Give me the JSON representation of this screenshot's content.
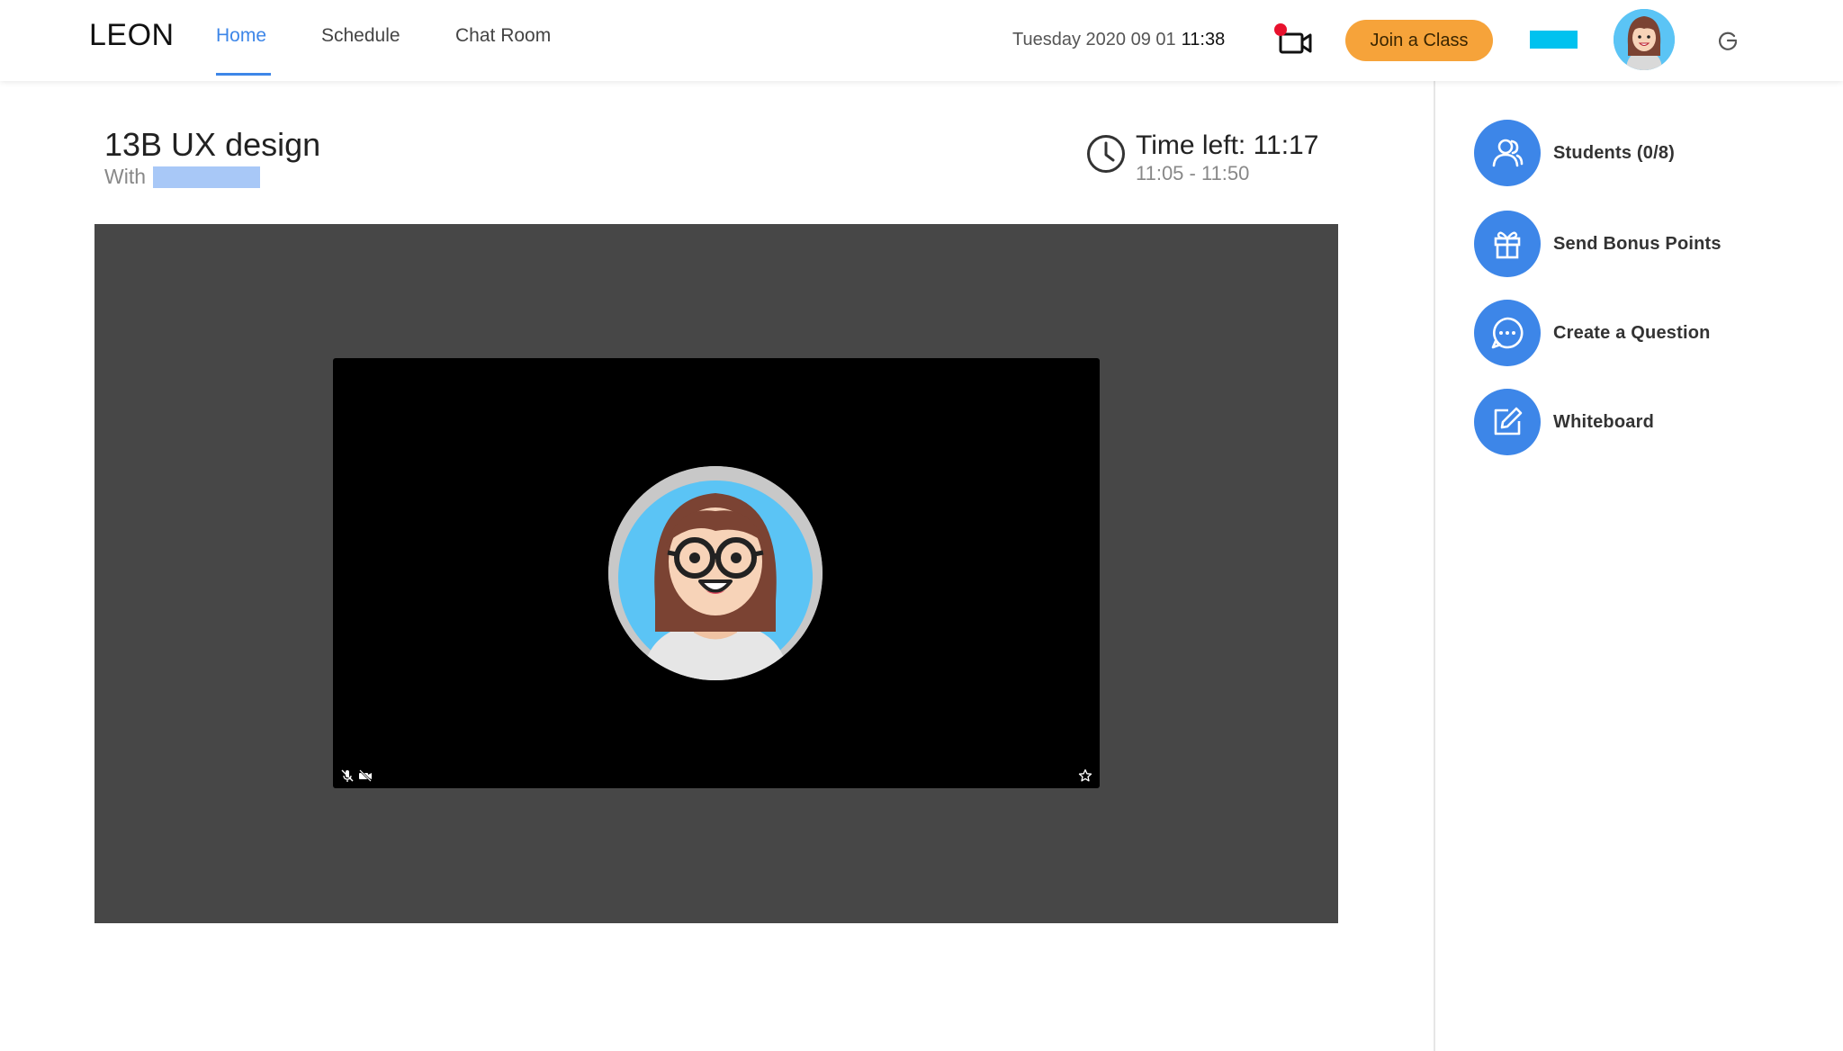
{
  "app": {
    "logo": "LEON"
  },
  "nav": {
    "items": [
      {
        "label": "Home",
        "active": true
      },
      {
        "label": "Schedule",
        "active": false
      },
      {
        "label": "Chat Room",
        "active": false
      }
    ]
  },
  "header": {
    "date": "Tuesday 2020 09 01",
    "time": "11:38",
    "join_label": "Join a Class",
    "icons": [
      "video-record-icon",
      "user-avatar",
      "refresh-icon"
    ]
  },
  "class": {
    "title": "13B UX design",
    "with_label": "With",
    "time_left": "Time left: 11:17",
    "time_range": "11:05 - 11:50"
  },
  "video": {
    "icons": [
      "mic-off-icon",
      "camera-off-icon",
      "star-icon"
    ]
  },
  "actions": [
    {
      "label": "Students (0/8)",
      "icon": "students-icon"
    },
    {
      "label": "Send Bonus Points",
      "icon": "gift-icon"
    },
    {
      "label": "Create a Question",
      "icon": "chat-bubble-icon"
    },
    {
      "label": "Whiteboard",
      "icon": "edit-icon"
    }
  ],
  "colors": {
    "accent": "#3d86e8",
    "join_button": "#f6a33a",
    "stage": "#474747",
    "cyan_block": "#00c2ef",
    "with_block": "#a8c8f7"
  }
}
